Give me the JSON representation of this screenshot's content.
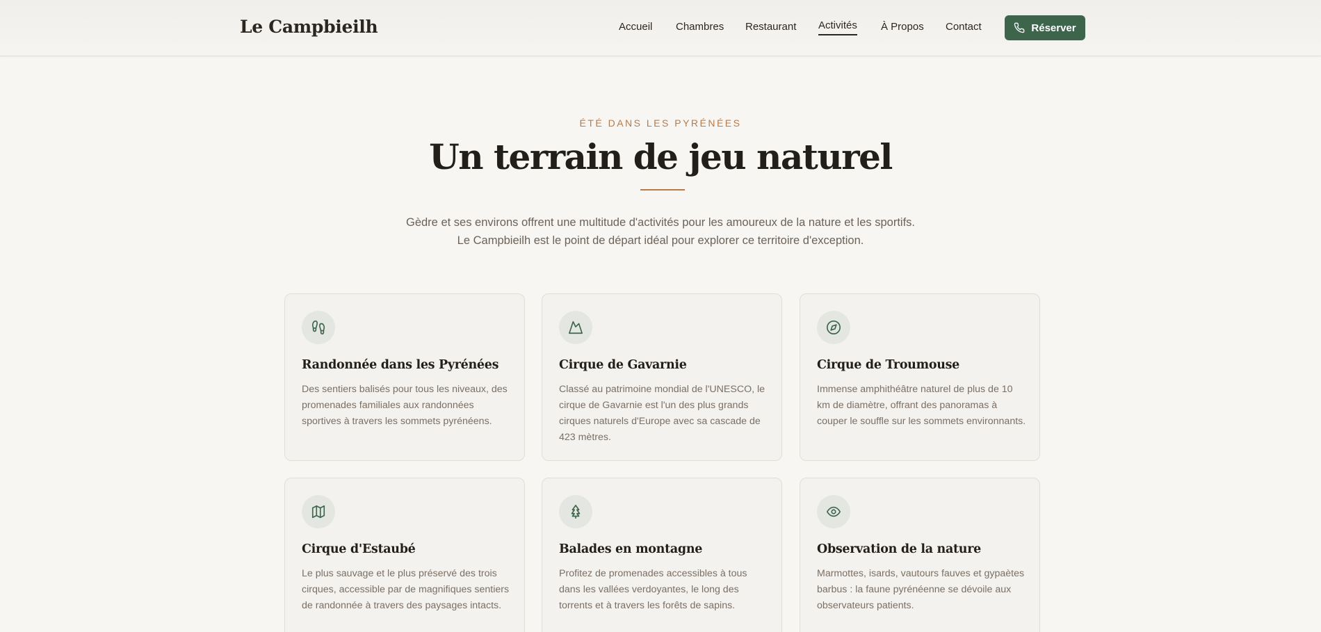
{
  "header": {
    "brand": "Le Campbieilh",
    "nav": [
      "Accueil",
      "Chambres",
      "Restaurant",
      "Activités",
      "À Propos",
      "Contact"
    ],
    "active_nav": "Activités",
    "cta_label": "Réserver",
    "cta_icon": "phone-icon"
  },
  "hero": {
    "eyebrow": "ÉTÉ DANS LES PYRÉNÉES",
    "title": "Un terrain de jeu naturel",
    "intro_line1": "Gèdre et ses environs offrent une multitude d'activités pour les amoureux de la nature et les sportifs.",
    "intro_line2": "Le Campbieilh est le point de départ idéal pour explorer ce territoire d'exception."
  },
  "colors": {
    "accent": "#b77a48",
    "brand_green": "#3d654c",
    "background": "#f8f6f3"
  },
  "activities": [
    {
      "icon": "footprints-icon",
      "title": "Randonnée dans les Pyrénées",
      "description": "Des sentiers balisés pour tous les niveaux, des promenades familiales aux randonnées sportives à travers les sommets pyrénéens."
    },
    {
      "icon": "mountain-icon",
      "title": "Cirque de Gavarnie",
      "description": "Classé au patrimoine mondial de l'UNESCO, le cirque de Gavarnie est l'un des plus grands cirques naturels d'Europe avec sa cascade de 423 mètres."
    },
    {
      "icon": "compass-icon",
      "title": "Cirque de Troumouse",
      "description": "Immense amphithéâtre naturel de plus de 10 km de diamètre, offrant des panoramas à couper le souffle sur les sommets environnants."
    },
    {
      "icon": "map-icon",
      "title": "Cirque d'Estaubé",
      "description": "Le plus sauvage et le plus préservé des trois cirques, accessible par de magnifiques sentiers de randonnée à travers des paysages intacts."
    },
    {
      "icon": "tree-icon",
      "title": "Balades en montagne",
      "description": "Profitez de promenades accessibles à tous dans les vallées verdoyantes, le long des torrents et à travers les forêts de sapins."
    },
    {
      "icon": "eye-icon",
      "title": "Observation de la nature",
      "description": "Marmottes, isards, vautours fauves et gypaètes barbus : la faune pyrénéenne se dévoile aux observateurs patients."
    }
  ]
}
